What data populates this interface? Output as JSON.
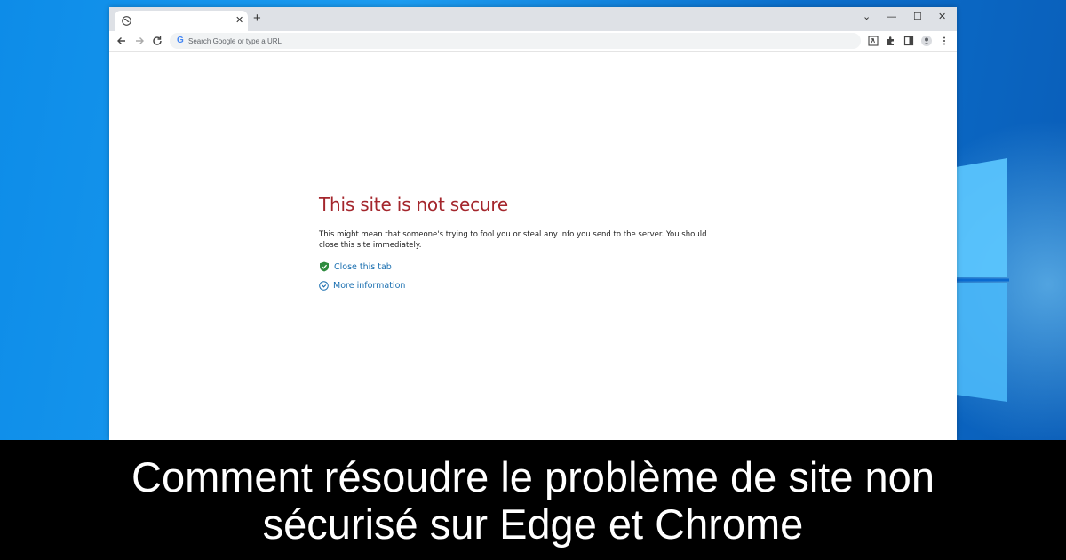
{
  "browser": {
    "tab_close_glyph": "✕",
    "new_tab_glyph": "+",
    "window_controls": {
      "dropdown": "⌄",
      "minimize": "—",
      "maximize": "☐",
      "close": "✕"
    },
    "omnibox": {
      "placeholder": "Search Google or type a URL",
      "value": ""
    }
  },
  "error_page": {
    "title": "This site is not secure",
    "description": "This might mean that someone's trying to fool you or steal any info you send to the server. You should close this site immediately.",
    "close_tab_label": "Close this tab",
    "more_info_label": "More information"
  },
  "caption": {
    "text": "Comment résoudre le problème de site non sécurisé sur Edge et Chrome"
  },
  "colors": {
    "error_title": "#a4262c",
    "link": "#1a6fb0",
    "desktop_blue": "#0a78d7",
    "caption_bg": "#000000"
  },
  "icons": [
    "globe-icon",
    "back-icon",
    "forward-icon",
    "reload-icon",
    "google-icon",
    "translate-icon",
    "extensions-icon",
    "reading-list-icon",
    "profile-icon",
    "menu-icon",
    "shield-check-icon",
    "chevron-circle-icon",
    "windows-logo-icon"
  ]
}
